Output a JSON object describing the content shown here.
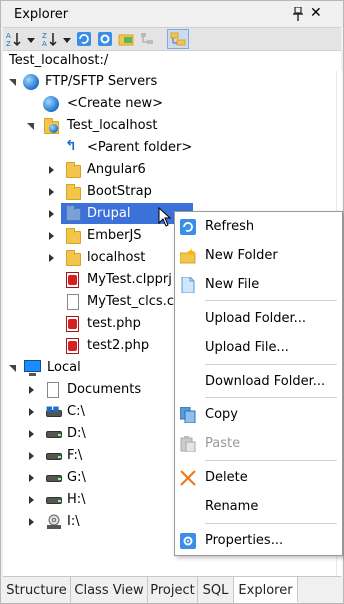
{
  "panel": {
    "title": "Explorer",
    "path": "Test_localhost:/"
  },
  "tree": {
    "items": [
      {
        "label": "FTP/SFTP Servers",
        "icon": "globe-icon"
      },
      {
        "label": "<Create new>",
        "icon": "globe-icon"
      },
      {
        "label": "Test_localhost",
        "icon": "server-folder-icon"
      },
      {
        "label": "<Parent folder>",
        "icon": "parent-folder-icon"
      },
      {
        "label": "Angular6",
        "icon": "folder-icon"
      },
      {
        "label": "BootStrap",
        "icon": "folder-icon"
      },
      {
        "label": "Drupal",
        "icon": "folder-icon",
        "selected": true
      },
      {
        "label": "EmberJS",
        "icon": "folder-icon"
      },
      {
        "label": "localhost",
        "icon": "folder-icon"
      },
      {
        "label": "MyTest.clpprj",
        "icon": "project-file-icon"
      },
      {
        "label": "MyTest_clcs.csp",
        "icon": "file-icon"
      },
      {
        "label": "test.php",
        "icon": "project-file-icon"
      },
      {
        "label": "test2.php",
        "icon": "project-file-icon"
      },
      {
        "label": "Local",
        "icon": "computer-icon"
      },
      {
        "label": "Documents",
        "icon": "documents-icon"
      },
      {
        "label": "C:\\",
        "icon": "drive-icon"
      },
      {
        "label": "D:\\",
        "icon": "drive-icon"
      },
      {
        "label": "F:\\",
        "icon": "drive-icon"
      },
      {
        "label": "G:\\",
        "icon": "drive-icon"
      },
      {
        "label": "H:\\",
        "icon": "drive-icon"
      },
      {
        "label": "I:\\",
        "icon": "drive-icon"
      }
    ]
  },
  "context_menu": {
    "items": [
      {
        "label": "Refresh",
        "icon": "refresh-icon",
        "enabled": true
      },
      {
        "label": "New Folder",
        "icon": "new-folder-icon",
        "enabled": true
      },
      {
        "label": "New File",
        "icon": "new-file-icon",
        "enabled": true
      },
      {
        "label": "Upload Folder...",
        "enabled": true
      },
      {
        "label": "Upload File...",
        "enabled": true
      },
      {
        "label": "Download Folder...",
        "enabled": true
      },
      {
        "label": "Copy",
        "icon": "copy-icon",
        "enabled": true
      },
      {
        "label": "Paste",
        "icon": "paste-icon",
        "enabled": false
      },
      {
        "label": "Delete",
        "icon": "delete-icon",
        "enabled": true
      },
      {
        "label": "Rename",
        "enabled": true
      },
      {
        "label": "Properties...",
        "icon": "properties-icon",
        "enabled": true
      }
    ]
  },
  "tabs": [
    {
      "label": "Structure",
      "active": false
    },
    {
      "label": "Class View",
      "active": false
    },
    {
      "label": "Project",
      "active": false
    },
    {
      "label": "SQL",
      "active": false
    },
    {
      "label": "Explorer",
      "active": true
    }
  ],
  "colors": {
    "selection": "#3b71d8",
    "folder": "#f3c54a",
    "accent_blue": "#1a6fc9",
    "delete_orange": "#f07a1c"
  }
}
